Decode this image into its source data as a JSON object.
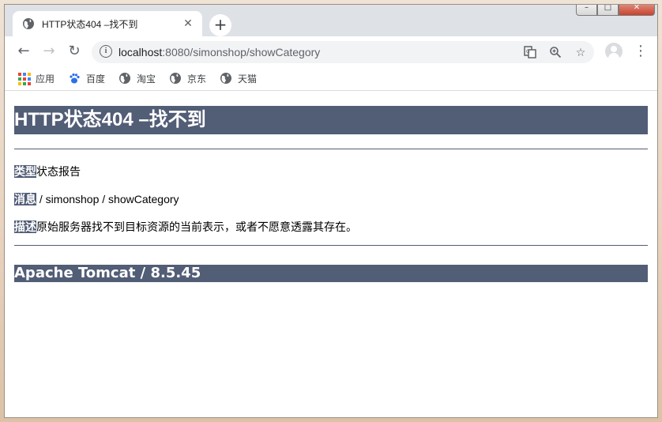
{
  "browser": {
    "tab_title": "HTTP状态404 –找不到",
    "tab_close": "✕",
    "new_tab": "+",
    "url_host": "localhost",
    "url_rest": ":8080/simonshop/showCategory",
    "window_min": "–",
    "window_max": "□",
    "window_close": "✕"
  },
  "bookmarks": [
    {
      "label": "应用",
      "icon": "apps-grid-icon"
    },
    {
      "label": "百度",
      "icon": "baidu-paw-icon"
    },
    {
      "label": "淘宝",
      "icon": "globe-icon"
    },
    {
      "label": "京东",
      "icon": "globe-icon"
    },
    {
      "label": "天猫",
      "icon": "globe-icon"
    }
  ],
  "page": {
    "heading": "HTTP状态404 –找不到",
    "type_label": "类型",
    "type_value": "状态报告",
    "message_label": "消息",
    "message_value": " / simonshop / showCategory",
    "desc_label": "描述",
    "desc_value": "原始服务器找不到目标资源的当前表示，或者不愿意透露其存在。",
    "footer": "Apache Tomcat / 8.5.45"
  },
  "colors": {
    "tomcat_header": "#525d76",
    "tabstrip": "#dee1e6"
  }
}
